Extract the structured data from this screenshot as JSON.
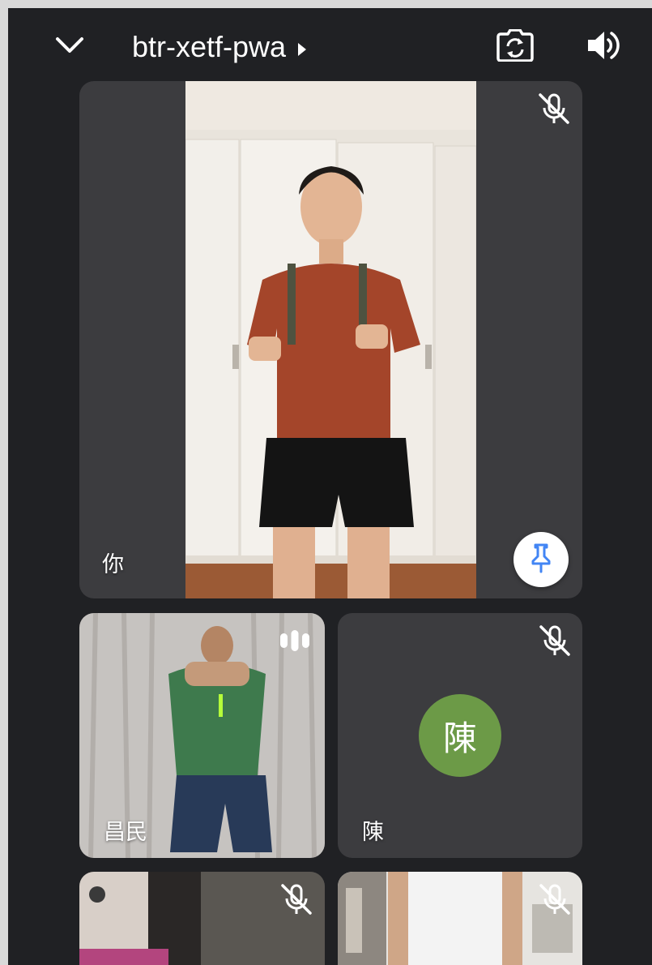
{
  "header": {
    "collapse_icon": "chevron-down-icon",
    "meeting_code": "btr-xetf-pwa",
    "details_icon": "caret-right-icon",
    "camera_switch_icon": "camera-flip-icon",
    "audio_output_icon": "speaker-icon"
  },
  "participants": [
    {
      "name": "你",
      "status_icon": "mic-off-icon",
      "has_video": true,
      "pin_icon": "pin-icon"
    },
    {
      "name": "昌民",
      "status_icon": "audio-level-icon",
      "has_video": true
    },
    {
      "name": "陳",
      "status_icon": "mic-off-icon",
      "has_video": false,
      "avatar_initial": "陳",
      "avatar_color": "#6c9a47"
    },
    {
      "status_icon": "mic-off-icon",
      "has_video": true
    },
    {
      "status_icon": "mic-off-icon",
      "has_video": true
    }
  ],
  "colors": {
    "background": "#202124",
    "tile": "#3c3c3f",
    "pin_blue": "#4285f4",
    "avatar_green": "#6c9a47"
  }
}
